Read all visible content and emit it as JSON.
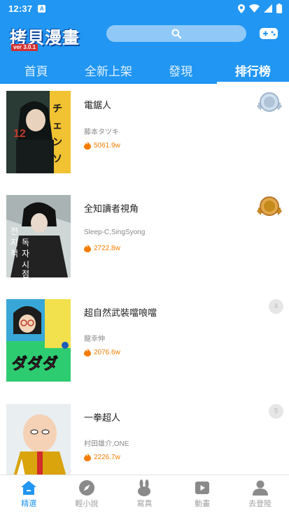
{
  "status_bar": {
    "time": "12:37",
    "notification_icon": "a-notification-icon"
  },
  "header": {
    "logo_text": "拷貝漫畫",
    "logo_version": "ver 3.0.1",
    "search_icon": "search-icon",
    "game_icon": "gamepad-icon"
  },
  "tabs": [
    {
      "label": "首頁",
      "active": false
    },
    {
      "label": "全新上架",
      "active": false
    },
    {
      "label": "發現",
      "active": false
    },
    {
      "label": "排行榜",
      "active": true
    }
  ],
  "rankings": [
    {
      "rank": "2",
      "title": "電鋸人",
      "author": "藤本タツキ",
      "views": "5061.9w",
      "badge": "silver-medal"
    },
    {
      "rank": "3",
      "title": "全知讀者視角",
      "author": "Sleep-C,SingSyong",
      "views": "2722.8w",
      "badge": "bronze-medal"
    },
    {
      "rank": "4",
      "title": "超自然武裝噹哴噹",
      "author": "龍幸伸",
      "views": "2076.6w",
      "badge": ""
    },
    {
      "rank": "5",
      "title": "一拳超人",
      "author": "村田雄介,ONE",
      "views": "2226.7w",
      "badge": ""
    }
  ],
  "bottom_nav": [
    {
      "label": "精選",
      "icon": "home-icon",
      "active": true
    },
    {
      "label": "輕小說",
      "icon": "compass-icon",
      "active": false
    },
    {
      "label": "寫真",
      "icon": "bunny-icon",
      "active": false
    },
    {
      "label": "動畫",
      "icon": "play-icon",
      "active": false
    },
    {
      "label": "去登陸",
      "icon": "user-icon",
      "active": false
    }
  ],
  "colors": {
    "primary": "#2196f3",
    "accent_orange": "#f57c00",
    "silver": "#b0c4d8",
    "bronze": "#c58a1c"
  }
}
